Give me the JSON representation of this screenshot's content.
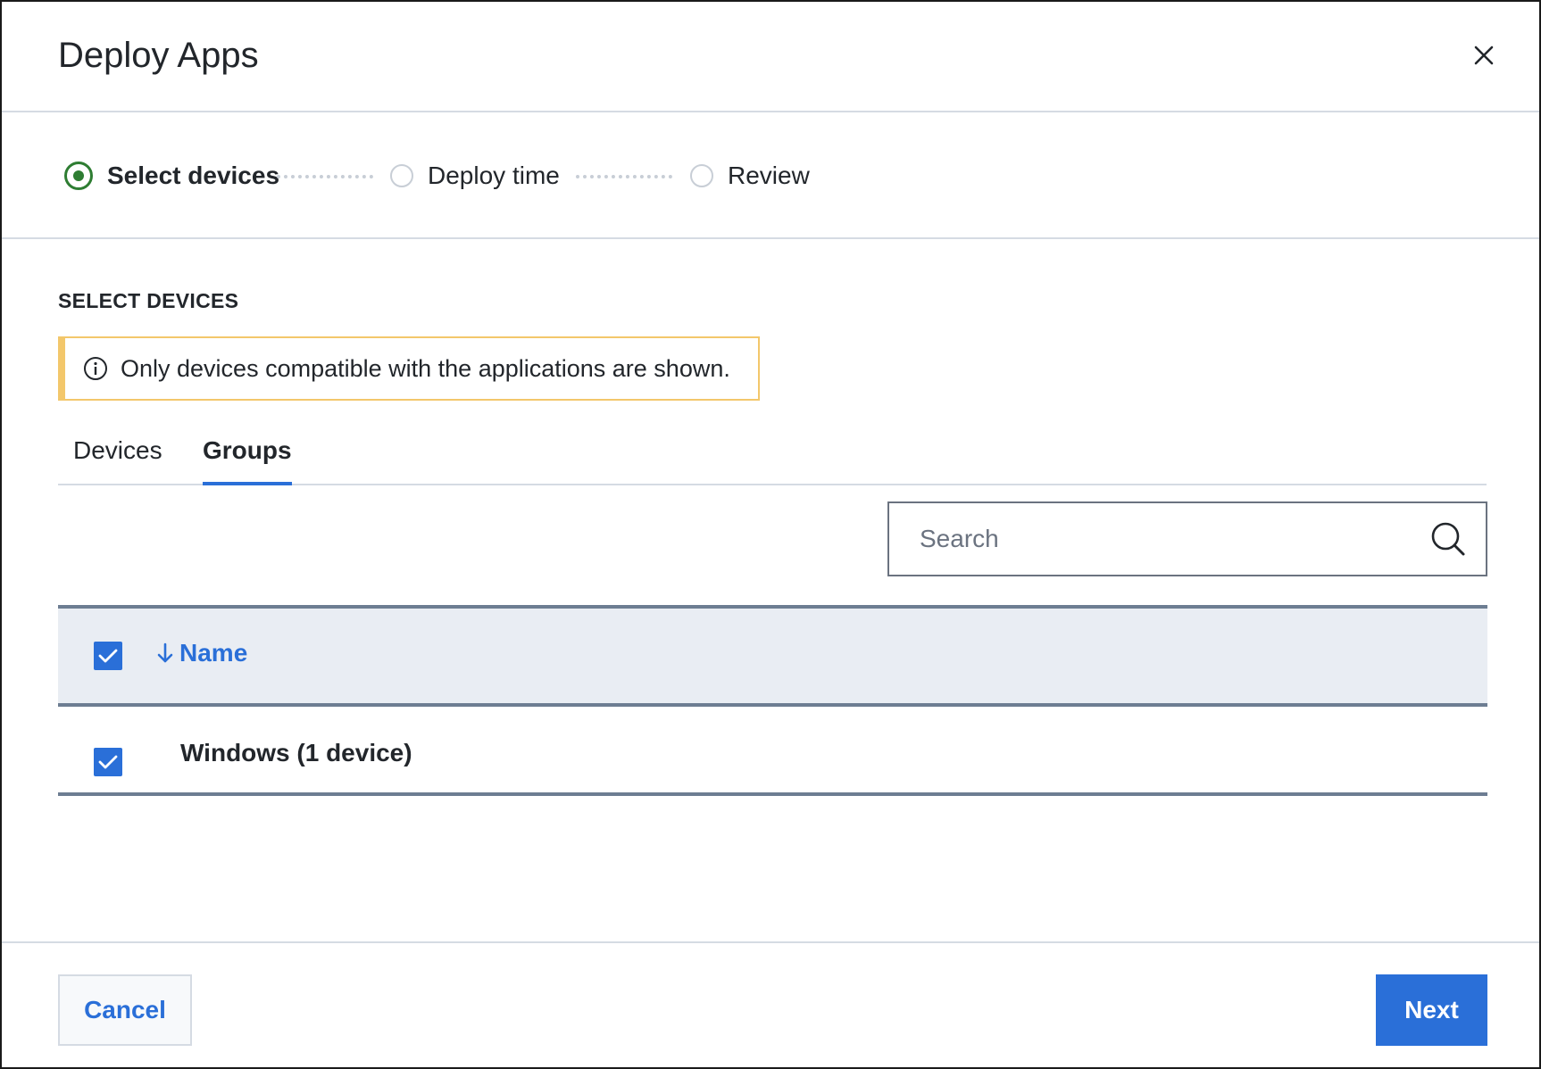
{
  "dialog": {
    "title": "Deploy Apps",
    "close_icon": "close-icon"
  },
  "stepper": {
    "steps": [
      {
        "label": "Select devices",
        "state": "active"
      },
      {
        "label": "Deploy time",
        "state": "pending"
      },
      {
        "label": "Review",
        "state": "pending"
      }
    ]
  },
  "section": {
    "title": "SELECT DEVICES",
    "alert_text": "Only devices compatible with the applications are shown.",
    "alert_icon": "info-icon"
  },
  "tabs": [
    {
      "label": "Devices",
      "active": false
    },
    {
      "label": "Groups",
      "active": true
    }
  ],
  "search": {
    "placeholder": "Search",
    "value": "",
    "icon": "search-icon"
  },
  "table": {
    "columns": [
      {
        "label": "Name",
        "sort": "descending"
      }
    ],
    "header_checked": true,
    "rows": [
      {
        "name": "Windows (1 device)",
        "checked": true
      }
    ]
  },
  "footer": {
    "cancel_label": "Cancel",
    "next_label": "Next"
  },
  "colors": {
    "accent": "#2a6fd8",
    "step_active": "#2e7d32",
    "alert_border": "#f3c76b",
    "header_bg": "#e9edf3"
  }
}
